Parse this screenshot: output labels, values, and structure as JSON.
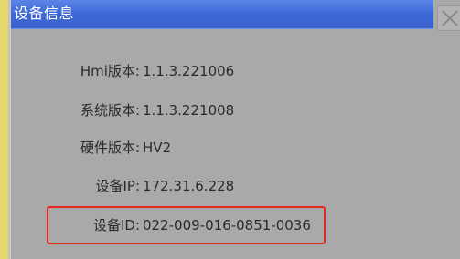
{
  "dialog": {
    "title": "设备信息"
  },
  "fields": [
    {
      "label": "Hmi版本:",
      "value": "1.1.3.221006"
    },
    {
      "label": "系统版本:",
      "value": "1.1.3.221008"
    },
    {
      "label": "硬件版本:",
      "value": "HV2"
    },
    {
      "label": "设备IP:",
      "value": "172.31.6.228"
    },
    {
      "label": "设备ID:",
      "value": "022-009-016-0851-0036"
    }
  ],
  "icons": {
    "close": "close-icon"
  },
  "colors": {
    "titlebar": "#3d67d6",
    "highlight_border": "#e8281e",
    "dialog_background": "#a9a9a9"
  }
}
